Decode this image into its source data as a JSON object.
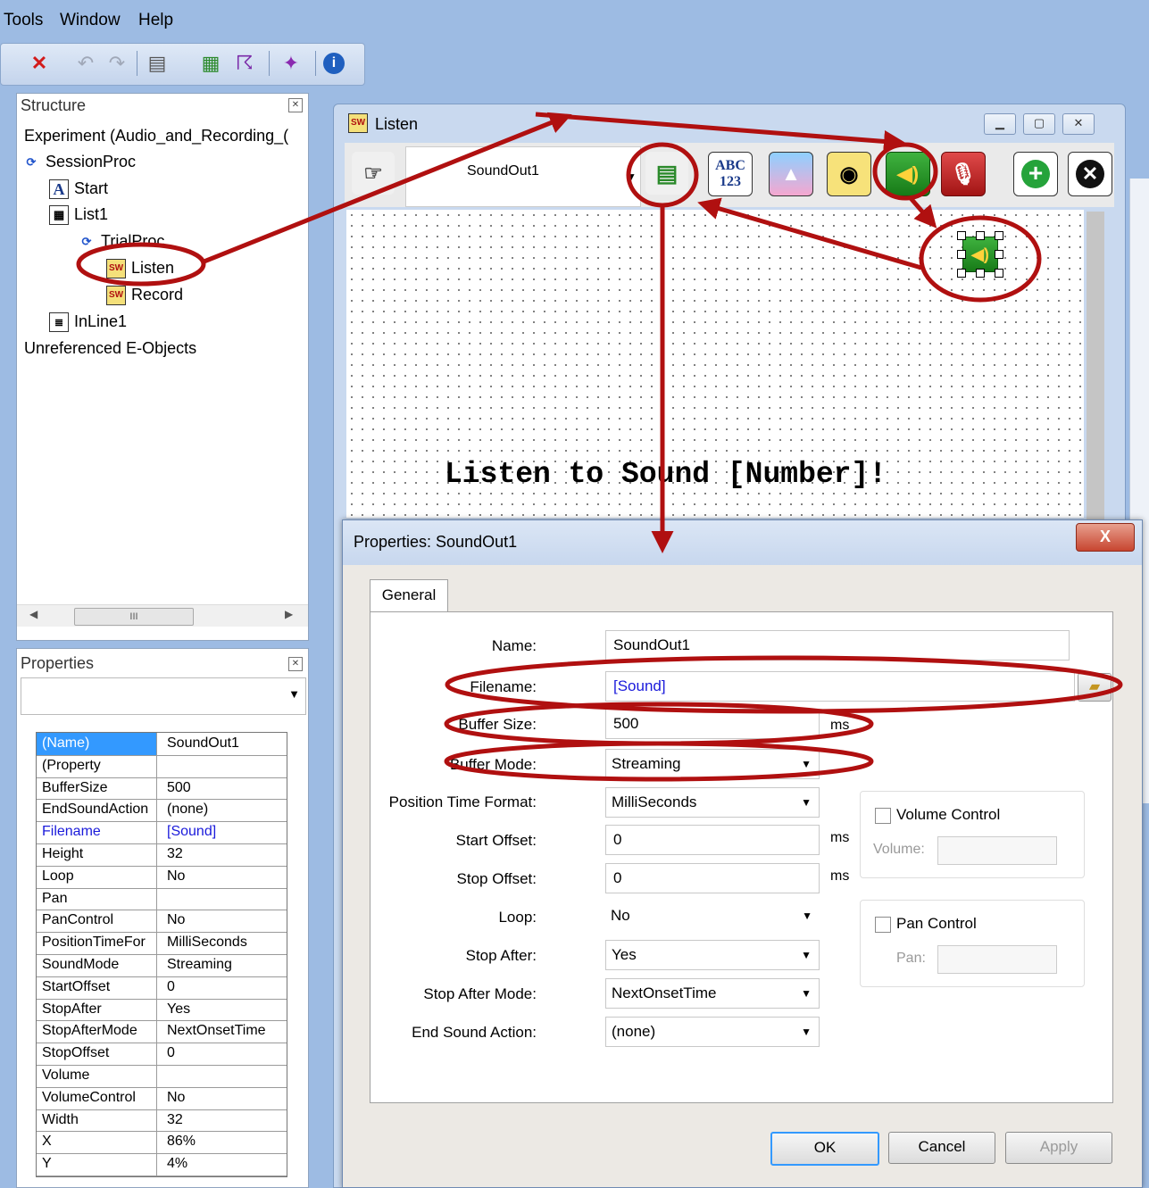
{
  "menubar": {
    "items": [
      "Tools",
      "Window",
      "Help"
    ]
  },
  "structure_panel": {
    "title": "Structure",
    "tree": [
      {
        "label": "Experiment (Audio_and_Recording_("
      },
      {
        "label": "SessionProc"
      },
      {
        "label": "Start"
      },
      {
        "label": "List1"
      },
      {
        "label": "TrialProc"
      },
      {
        "label": "Listen"
      },
      {
        "label": "Record"
      },
      {
        "label": "InLine1"
      },
      {
        "label": "Unreferenced E-Objects"
      }
    ],
    "scroll_grip": "III"
  },
  "properties_panel": {
    "title": "Properties",
    "rows": [
      {
        "key": "(Name)",
        "value": "SoundOut1"
      },
      {
        "key": "(Property",
        "value": ""
      },
      {
        "key": "BufferSize",
        "value": "500"
      },
      {
        "key": "EndSoundAction",
        "value": "(none)"
      },
      {
        "key": "Filename",
        "value": "[Sound]"
      },
      {
        "key": "Height",
        "value": "32"
      },
      {
        "key": "Loop",
        "value": "No"
      },
      {
        "key": "Pan",
        "value": ""
      },
      {
        "key": "PanControl",
        "value": "No"
      },
      {
        "key": "PositionTimeFor",
        "value": "MilliSeconds"
      },
      {
        "key": "SoundMode",
        "value": "Streaming"
      },
      {
        "key": "StartOffset",
        "value": "0"
      },
      {
        "key": "StopAfter",
        "value": "Yes"
      },
      {
        "key": "StopAfterMode",
        "value": "NextOnsetTime"
      },
      {
        "key": "StopOffset",
        "value": "0"
      },
      {
        "key": "Volume",
        "value": ""
      },
      {
        "key": "VolumeControl",
        "value": "No"
      },
      {
        "key": "Width",
        "value": "32"
      },
      {
        "key": "X",
        "value": "86%"
      },
      {
        "key": "Y",
        "value": "4%"
      }
    ]
  },
  "listen_window": {
    "title": "Listen",
    "object_combo": "SoundOut1",
    "toolbar_icons": [
      "abc123",
      "image",
      "movie",
      "sound-out",
      "sound-in",
      "add",
      "remove"
    ],
    "toolbar_abc": "ABC",
    "toolbar_123": "123",
    "canvas_text": "Listen to Sound [Number]!"
  },
  "dialog": {
    "title": "Properties: SoundOut1",
    "close_label": "X",
    "tab": "General",
    "fields": {
      "name": {
        "label": "Name:",
        "value": "SoundOut1"
      },
      "filename": {
        "label": "Filename:",
        "value": "[Sound]"
      },
      "buffer_size": {
        "label": "Buffer Size:",
        "value": "500",
        "unit": "ms"
      },
      "buffer_mode": {
        "label": "Buffer Mode:",
        "value": "Streaming"
      },
      "position_time_format": {
        "label": "Position Time Format:",
        "value": "MilliSeconds"
      },
      "start_offset": {
        "label": "Start Offset:",
        "value": "0",
        "unit": "ms"
      },
      "stop_offset": {
        "label": "Stop Offset:",
        "value": "0",
        "unit": "ms"
      },
      "loop": {
        "label": "Loop:",
        "value": "No"
      },
      "stop_after": {
        "label": "Stop After:",
        "value": "Yes"
      },
      "stop_after_mode": {
        "label": "Stop After Mode:",
        "value": "NextOnsetTime"
      },
      "end_sound_action": {
        "label": "End Sound Action:",
        "value": "(none)"
      }
    },
    "volume_group": {
      "checkbox": "Volume Control",
      "label": "Volume:"
    },
    "pan_group": {
      "checkbox": "Pan Control",
      "label": "Pan:"
    },
    "buttons": {
      "ok": "OK",
      "cancel": "Cancel",
      "apply": "Apply"
    }
  },
  "colors": {
    "annotation": "#b01010",
    "accent_blue": "#3399ff",
    "link_blue": "#1a1adb"
  }
}
